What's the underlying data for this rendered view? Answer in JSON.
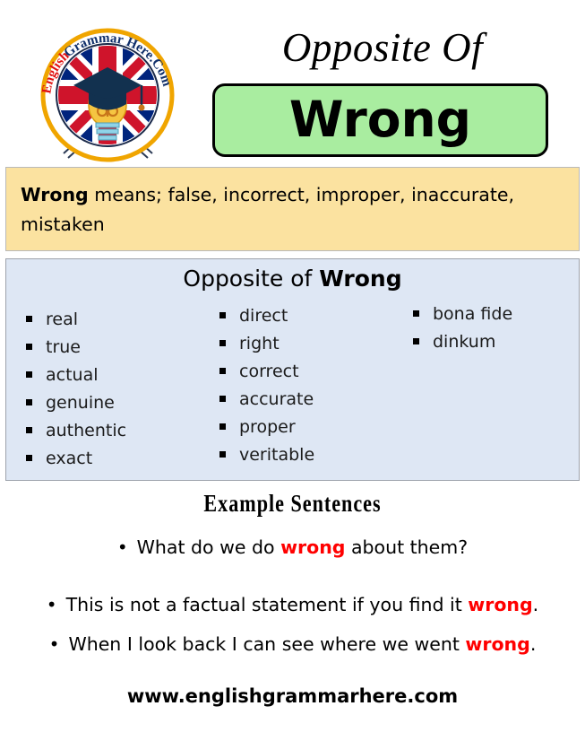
{
  "header": {
    "logo": {
      "name": "english-grammar-here-logo",
      "text_red": "English",
      "text_navy": "Grammar Here.Com",
      "ring_color": "#f0a500",
      "inner_emblem": "union-jack-graduation-cap-lightbulb"
    },
    "title": "Opposite Of",
    "word": "Wrong",
    "word_box_color": "#a9eda0",
    "word_box_border_color": "#000000"
  },
  "meaning": {
    "word": "Wrong",
    "connector": " means; ",
    "definitions": "false, incorrect, improper, inaccurate, mistaken",
    "full_text": "Wrong means; false, incorrect, improper, inaccurate, mistaken",
    "background_color": "#fbe2a0"
  },
  "opposites": {
    "heading_prefix": "Opposite of ",
    "heading_word": "Wrong",
    "background_color": "#dee7f4",
    "columns": [
      {
        "items": [
          "real",
          "true",
          "actual",
          "genuine",
          "authentic",
          "exact"
        ]
      },
      {
        "items": [
          "direct",
          "right",
          "correct",
          "accurate",
          "proper",
          "veritable"
        ]
      },
      {
        "items": [
          "bona fide",
          "dinkum"
        ]
      }
    ]
  },
  "examples": {
    "heading": "Example Sentences",
    "highlight_color": "#ff0000",
    "sentences": [
      {
        "bullet": "•",
        "before": "What do we do ",
        "highlight": "wrong",
        "after": " about them?"
      },
      {
        "bullet": "•",
        "before": "This is not a factual statement if you find it ",
        "highlight": "wrong",
        "after": "."
      },
      {
        "bullet": "•",
        "before": "When I look back I can see where we went ",
        "highlight": "wrong",
        "after": "."
      }
    ]
  },
  "footer": {
    "site_url": "www.englishgrammarhere.com"
  }
}
